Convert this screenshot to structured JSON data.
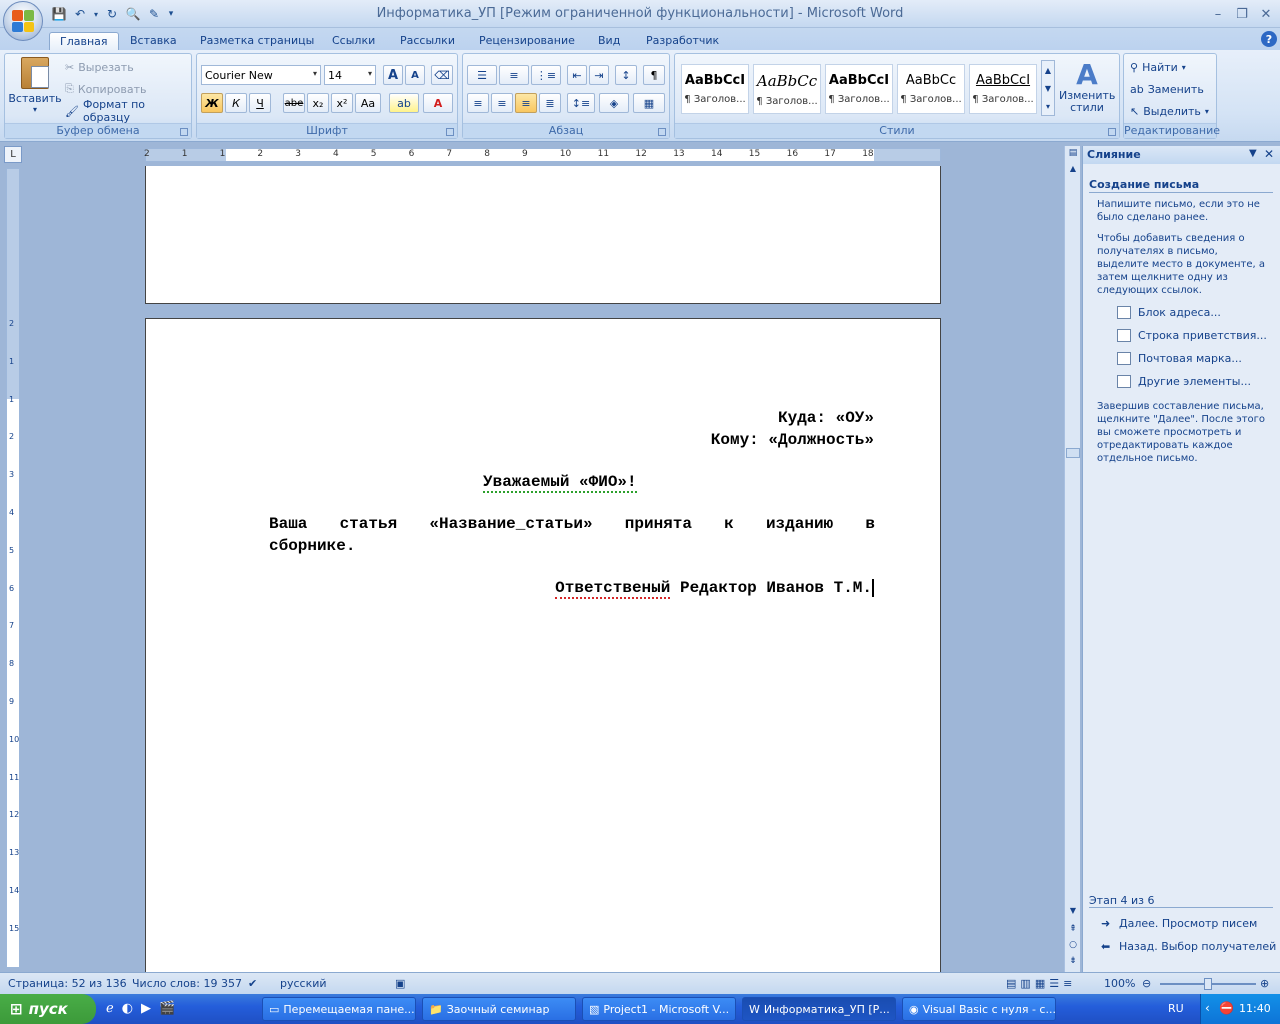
{
  "window": {
    "title": "Информатика_УП [Режим ограниченной функциональности] - Microsoft Word",
    "minimize": "–",
    "restore": "❐",
    "close": "✕",
    "help": "?"
  },
  "quick_access": [
    "save-icon",
    "undo-icon",
    "redo-icon",
    "print-preview-icon",
    "spelling-icon",
    "customize-icon"
  ],
  "tabs": [
    "Главная",
    "Вставка",
    "Разметка страницы",
    "Ссылки",
    "Рассылки",
    "Рецензирование",
    "Вид",
    "Разработчик"
  ],
  "active_tab": "Главная",
  "ribbon": {
    "clipboard": {
      "label": "Буфер обмена",
      "paste": "Вставить",
      "cut": "Вырезать",
      "copy": "Копировать",
      "format_painter": "Формат по образцу"
    },
    "font": {
      "label": "Шрифт",
      "font_name": "Courier New",
      "font_size": "14",
      "bold": "Ж",
      "italic": "К",
      "underline": "Ч",
      "strike": "abe",
      "subscript": "x₂",
      "superscript": "x²",
      "case": "Aa",
      "grow": "A",
      "shrink": "A"
    },
    "paragraph": {
      "label": "Абзац"
    },
    "styles": {
      "label": "Стили",
      "items": [
        {
          "sample": "AaBbCcI",
          "name": "¶ Заголов..."
        },
        {
          "sample": "AaBbCc",
          "name": "¶ Заголов..."
        },
        {
          "sample": "AaBbCcI",
          "name": "¶ Заголов..."
        },
        {
          "sample": "AaBbCc",
          "name": "¶ Заголов..."
        },
        {
          "sample": "AaBbCcI",
          "name": "¶ Заголов..."
        }
      ],
      "change_styles": "Изменить стили"
    },
    "editing": {
      "label": "Редактирование",
      "find": "Найти",
      "replace": "Заменить",
      "select": "Выделить"
    }
  },
  "ruler": {
    "corner": "L",
    "ticks": [
      "2",
      "1",
      "1",
      "2",
      "3",
      "4",
      "5",
      "6",
      "7",
      "8",
      "9",
      "10",
      "11",
      "12",
      "13",
      "14",
      "15",
      "16",
      "17",
      "18"
    ],
    "vticks": [
      "2",
      "1",
      "1",
      "2",
      "3",
      "4",
      "5",
      "6",
      "7",
      "8",
      "9",
      "10",
      "11",
      "12",
      "13",
      "14",
      "15"
    ]
  },
  "document": {
    "line_to": "Куда: «ОУ»",
    "line_whom": "Кому: «Должность»",
    "greeting": "Уважаемый «ФИО»!",
    "body_words": [
      "Ваша",
      "статья",
      "«Название_статьи»",
      "принята",
      "к",
      "изданию",
      "в"
    ],
    "body_line2": "сборнике.",
    "sig_word1": "Ответственый",
    "sig_rest": " Редактор Иванов Т.М."
  },
  "task_pane": {
    "title": "Слияние",
    "section": "Создание письма",
    "intro": "Напишите письмо, если это не было сделано ранее.",
    "instructions": "Чтобы добавить сведения о получателях в письмо, выделите место в документе, а затем щелкните одну из следующих ссылок.",
    "links": [
      "Блок адреса...",
      "Строка приветствия...",
      "Почтовая марка...",
      "Другие элементы..."
    ],
    "finish": "Завершив составление письма, щелкните \"Далее\". После этого вы сможете просмотреть и отредактировать каждое отдельное письмо.",
    "step": "Этап 4 из 6",
    "next": "Далее. Просмотр писем",
    "prev": "Назад. Выбор получателей"
  },
  "status": {
    "page": "Страница: 52 из 136",
    "words": "Число слов: 19 357",
    "language": "русский",
    "zoom": "100%"
  },
  "taskbar": {
    "start": "пуск",
    "tasks": [
      "Перемещаемая пане...",
      "Заочный семинар",
      "Project1 - Microsoft V...",
      "Информатика_УП [Р...",
      "Visual Basic с нуля - с..."
    ],
    "active_task": "Информатика_УП [Р...",
    "lang": "RU",
    "time": "11:40"
  }
}
